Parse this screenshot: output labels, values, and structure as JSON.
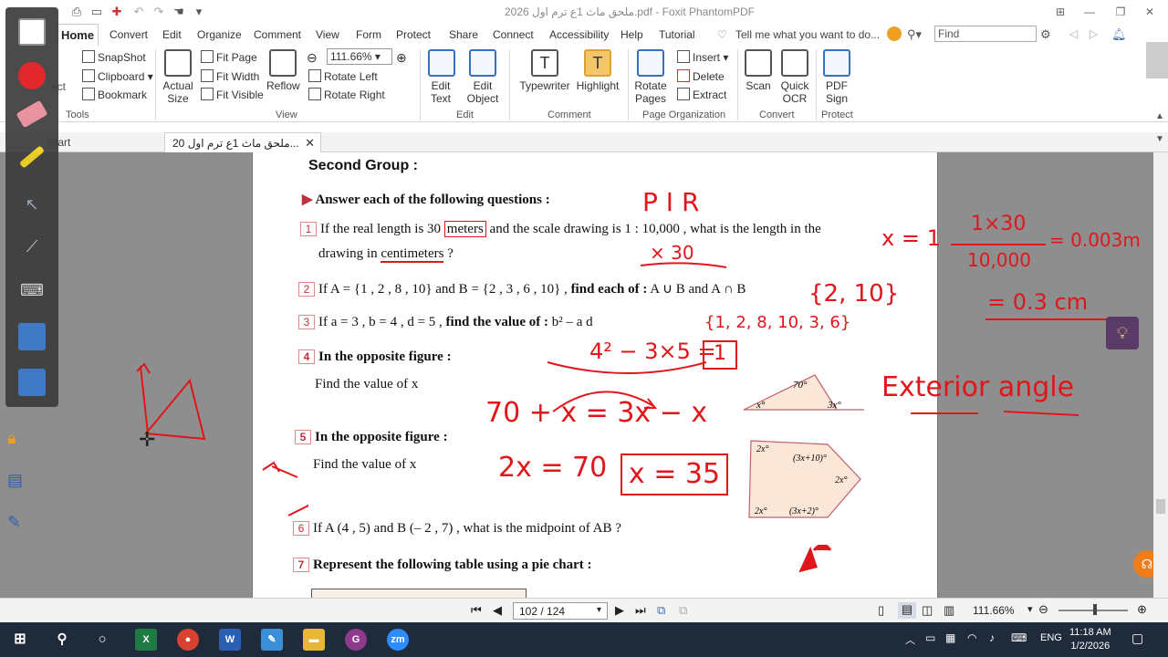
{
  "app": {
    "window_title": "ملحق ماث 1ع ترم اول 2026.pdf - Foxit PhantomPDF"
  },
  "menu": {
    "items": [
      "Home",
      "Convert",
      "Edit",
      "Organize",
      "Comment",
      "View",
      "Form",
      "Protect",
      "Share",
      "Connect",
      "Accessibility",
      "Help",
      "Tutorial"
    ],
    "tell_me": "Tell me what you want to do...",
    "find_placeholder": "Find"
  },
  "ribbon": {
    "tools": {
      "snapshot": "SnapShot",
      "clipboard": "Clipboard",
      "bookmark": "Bookmark",
      "group": "Tools",
      "select_partial": "ect"
    },
    "view": {
      "actual_size": "Actual Size",
      "fit_page": "Fit Page",
      "fit_width": "Fit Width",
      "fit_visible": "Fit Visible",
      "reflow": "Reflow",
      "zoom_value": "111.66%",
      "rotate_left": "Rotate Left",
      "rotate_right": "Rotate Right",
      "group": "View"
    },
    "edit": {
      "edit_text": "Edit Text",
      "edit_object": "Edit Object",
      "group": "Edit"
    },
    "comment": {
      "typewriter": "Typewriter",
      "highlight": "Highlight",
      "group": "Comment"
    },
    "page_org": {
      "rotate_pages": "Rotate Pages",
      "insert": "Insert",
      "delete": "Delete",
      "extract": "Extract",
      "group": "Page Organization"
    },
    "convert": {
      "scan": "Scan",
      "quick_ocr": "Quick OCR",
      "group": "Convert"
    },
    "protect": {
      "pdf_sign": "PDF Sign",
      "group": "Protect"
    }
  },
  "tabs": {
    "start": "Start",
    "doc": "ملحق ماث 1ع ترم اول 20..."
  },
  "doc": {
    "section": "Second Group :",
    "instruction": "Answer each of the following questions :",
    "q1_num": "1",
    "q1a": "If the real length is 30",
    "q1_meters": "meters",
    "q1b": "and the scale drawing is 1 : 10,000 , what is the length in the",
    "q1c": "drawing in",
    "q1_cm": "centimeters",
    "q1d": "?",
    "q2_num": "2",
    "q2a": "If A = {1 , 2 , 8 , 10} and B = {2 , 3 , 6 , 10} ,",
    "q2b": "find each of :",
    "q2c": "A ∪ B and A ∩ B",
    "q3_num": "3",
    "q3a": "If a = 3   ,   b = 4   ,   d = 5 ,",
    "q3b": "find the value of :",
    "q3c": "b² – a d",
    "q4_num": "4",
    "q4a": "In the opposite figure :",
    "q4b": "Find the value of x",
    "q5_num": "5",
    "q5a": "In the opposite figure :",
    "q5b": "Find the value of x",
    "q6_num": "6",
    "q6a": "If A (4 , 5) and B (– 2 , 7) , what is the midpoint of AB ?",
    "q7_num": "7",
    "q7a": "Represent the following table using a pie chart :",
    "fig4": {
      "a": "x°",
      "b": "70°",
      "c": "3x°"
    },
    "fig5": {
      "a": "2x°",
      "b": "(3x+10)°",
      "c": "2x°",
      "d": "(3x+2)°",
      "e": "2x°"
    }
  },
  "ink": {
    "pir": "P I R",
    "times30": "× 30",
    "x_eq": "x = 1",
    "frac_num": "1×30",
    "frac_den": "10,000",
    "frac_res": "= 0.003m",
    "cm_res": "= 0.3 cm",
    "inter": "{2, 10}",
    "union": "{1, 2, 8, 10, 3, 6}",
    "q3_work": "4² − 3×5 =",
    "q3_ans": "1",
    "ext": "Exterior angle",
    "eq1": "70 + x = 3x − x",
    "eq2": "2x = 70",
    "ans5": "x = 35"
  },
  "status": {
    "page": "102 / 124",
    "zoom": "111.66%"
  },
  "taskbar": {
    "time": "11:18 AM",
    "date": "1/2/2026",
    "lang": "ENG"
  },
  "colors": {
    "ink": "#e0161b",
    "accent": "#3b6fb6",
    "number_box": "#e08a8a"
  }
}
